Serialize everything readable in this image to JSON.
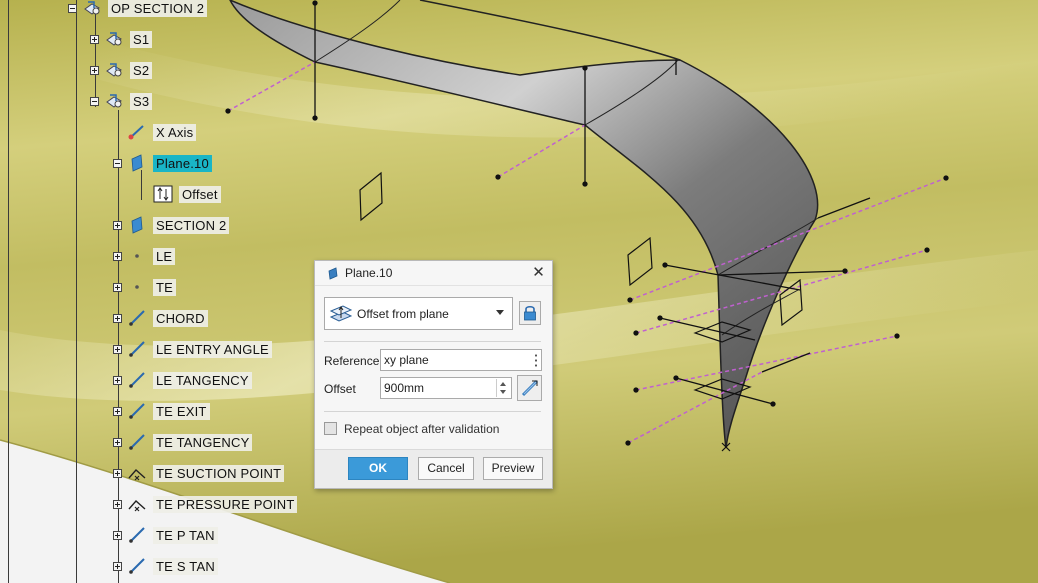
{
  "tree": {
    "root": {
      "label": "OP SECTION 2",
      "icon": "part-body-icon"
    },
    "items": [
      {
        "key": "s1",
        "label": "S1",
        "icon": "sketch-body-icon",
        "expander": "plus"
      },
      {
        "key": "s2",
        "label": "S2",
        "icon": "sketch-body-icon",
        "expander": "plus"
      },
      {
        "key": "s3",
        "label": "S3",
        "icon": "sketch-body-icon",
        "expander": "minus"
      },
      {
        "key": "xaxis",
        "label": "X Axis",
        "icon": "axis-line-icon"
      },
      {
        "key": "plane10",
        "label": "Plane.10",
        "icon": "plane-icon",
        "expander": "minus",
        "selected": true
      },
      {
        "key": "offset",
        "label": "Offset",
        "icon": "offset-parameter-icon"
      },
      {
        "key": "section2",
        "label": "SECTION 2",
        "icon": "plane-icon",
        "expander": "plus"
      },
      {
        "key": "le",
        "label": "LE",
        "icon": "point-icon",
        "expander": "plus"
      },
      {
        "key": "te",
        "label": "TE",
        "icon": "point-icon",
        "expander": "plus"
      },
      {
        "key": "chord",
        "label": "CHORD",
        "icon": "line-icon",
        "expander": "plus"
      },
      {
        "key": "le_entry",
        "label": "LE ENTRY ANGLE",
        "icon": "line-icon",
        "expander": "plus"
      },
      {
        "key": "le_tan",
        "label": "LE TANGENCY",
        "icon": "line-icon",
        "expander": "plus"
      },
      {
        "key": "te_exit",
        "label": "TE EXIT",
        "icon": "line-icon",
        "expander": "plus"
      },
      {
        "key": "te_tan",
        "label": "TE TANGENCY",
        "icon": "line-icon",
        "expander": "plus"
      },
      {
        "key": "te_suction",
        "label": "TE SUCTION POINT",
        "icon": "point-intersection-icon",
        "expander": "plus"
      },
      {
        "key": "te_pressure",
        "label": "TE PRESSURE POINT",
        "icon": "point-intersection-icon",
        "expander": "plus"
      },
      {
        "key": "te_ptan",
        "label": "TE P TAN",
        "icon": "line-icon",
        "expander": "plus"
      },
      {
        "key": "te_stan",
        "label": "TE S TAN",
        "icon": "line-icon",
        "expander": "plus"
      }
    ]
  },
  "dialog": {
    "title": "Plane.10",
    "title_icon": "plane-icon",
    "close_icon": "close-icon",
    "plane_type": "Offset from plane",
    "plane_type_icon": "offset-plane-icon",
    "lock_icon": "lock-icon",
    "reference_label": "Reference",
    "reference_value": "xy plane",
    "offset_label": "Offset",
    "offset_value": "900mm",
    "measure_icon": "measure-icon",
    "repeat_label": "Repeat object after validation",
    "repeat_checked": false,
    "ok_label": "OK",
    "cancel_label": "Cancel",
    "preview_label": "Preview"
  },
  "colors": {
    "surface_yellow": "#c9c46a",
    "selection": "#19b5c6",
    "ok_button": "#3b9ad9",
    "construction_line": "#c060d0"
  }
}
